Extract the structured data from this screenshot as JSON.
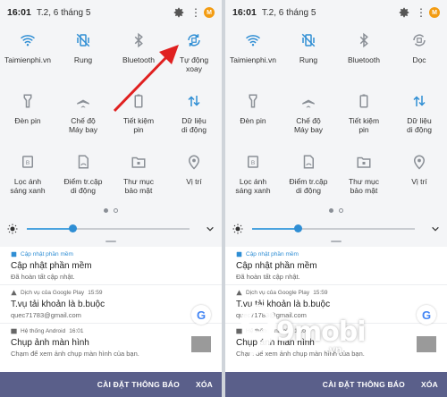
{
  "left": {
    "status": {
      "time": "16:01",
      "date": "T.2, 6 tháng 5",
      "avatar_letter": "M"
    },
    "tiles": [
      {
        "label": "Taimienphi.vn",
        "icon": "wifi-icon",
        "active": true
      },
      {
        "label": "Rung",
        "icon": "vibrate-icon",
        "active": true
      },
      {
        "label": "Bluetooth",
        "icon": "bluetooth-icon",
        "active": false
      },
      {
        "label": "Tự động\nxoay",
        "icon": "auto-rotate-icon",
        "active": true
      },
      {
        "label": "Đèn pin",
        "icon": "flashlight-icon",
        "active": false
      },
      {
        "label": "Chế độ\nMáy bay",
        "icon": "airplane-icon",
        "active": false
      },
      {
        "label": "Tiết kiệm\npin",
        "icon": "battery-saver-icon",
        "active": false
      },
      {
        "label": "Dữ liệu\ndi động",
        "icon": "mobile-data-icon",
        "active": true
      },
      {
        "label": "Lọc ánh\nsáng xanh",
        "icon": "blue-light-filter-icon",
        "active": false
      },
      {
        "label": "Điểm tr.cập\ndi động",
        "icon": "hotspot-icon",
        "active": false
      },
      {
        "label": "Thư mục\nbảo mật",
        "icon": "secure-folder-icon",
        "active": false
      },
      {
        "label": "Vị trí",
        "icon": "location-icon",
        "active": false
      }
    ]
  },
  "right": {
    "status": {
      "time": "16:01",
      "date": "T.2, 6 tháng 5",
      "avatar_letter": "M"
    },
    "tiles": [
      {
        "label": "Taimienphi.vn",
        "icon": "wifi-icon",
        "active": true
      },
      {
        "label": "Rung",
        "icon": "vibrate-icon",
        "active": true
      },
      {
        "label": "Bluetooth",
        "icon": "bluetooth-icon",
        "active": false
      },
      {
        "label": "Dọc",
        "icon": "portrait-lock-icon",
        "active": false
      },
      {
        "label": "Đèn pin",
        "icon": "flashlight-icon",
        "active": false
      },
      {
        "label": "Chế độ\nMáy bay",
        "icon": "airplane-icon",
        "active": false
      },
      {
        "label": "Tiết kiệm\npin",
        "icon": "battery-saver-icon",
        "active": false
      },
      {
        "label": "Dữ liệu\ndi động",
        "icon": "mobile-data-icon",
        "active": true
      },
      {
        "label": "Lọc ánh\nsáng xanh",
        "icon": "blue-light-filter-icon",
        "active": false
      },
      {
        "label": "Điểm tr.cập\ndi động",
        "icon": "hotspot-icon",
        "active": false
      },
      {
        "label": "Thư mục\nbảo mật",
        "icon": "secure-folder-icon",
        "active": false
      },
      {
        "label": "Vị trí",
        "icon": "location-icon",
        "active": false
      }
    ]
  },
  "brightness_level": 0.28,
  "notifications": {
    "update": {
      "app": "Cập nhật phần mềm",
      "title": "Cập nhật phần mềm",
      "text": "Đã hoàn tất cập nhật."
    },
    "google_play": {
      "app": "Dịch vụ của Google Play",
      "time": "15:59",
      "title": "T.vụ tải khoản là b.buộc",
      "text": "quec71783@gmail.com",
      "logo_letter": "G"
    },
    "screenshot": {
      "app": "Hệ thống Android",
      "time": "16:01",
      "title": "Chụp ảnh màn hình",
      "text": "Chạm để xem ảnh chụp màn hình của bạn."
    }
  },
  "actions": {
    "settings_label": "CÀI ĐẶT THÔNG BÁO",
    "clear_label": "XÓA"
  },
  "watermark": {
    "brand": "9mobi",
    "suffix": ".vn"
  },
  "colors": {
    "accent": "#2f8ed4",
    "inactive": "#8a8f96",
    "action_bar": "#5a5f8a",
    "arrow": "#e02020"
  }
}
